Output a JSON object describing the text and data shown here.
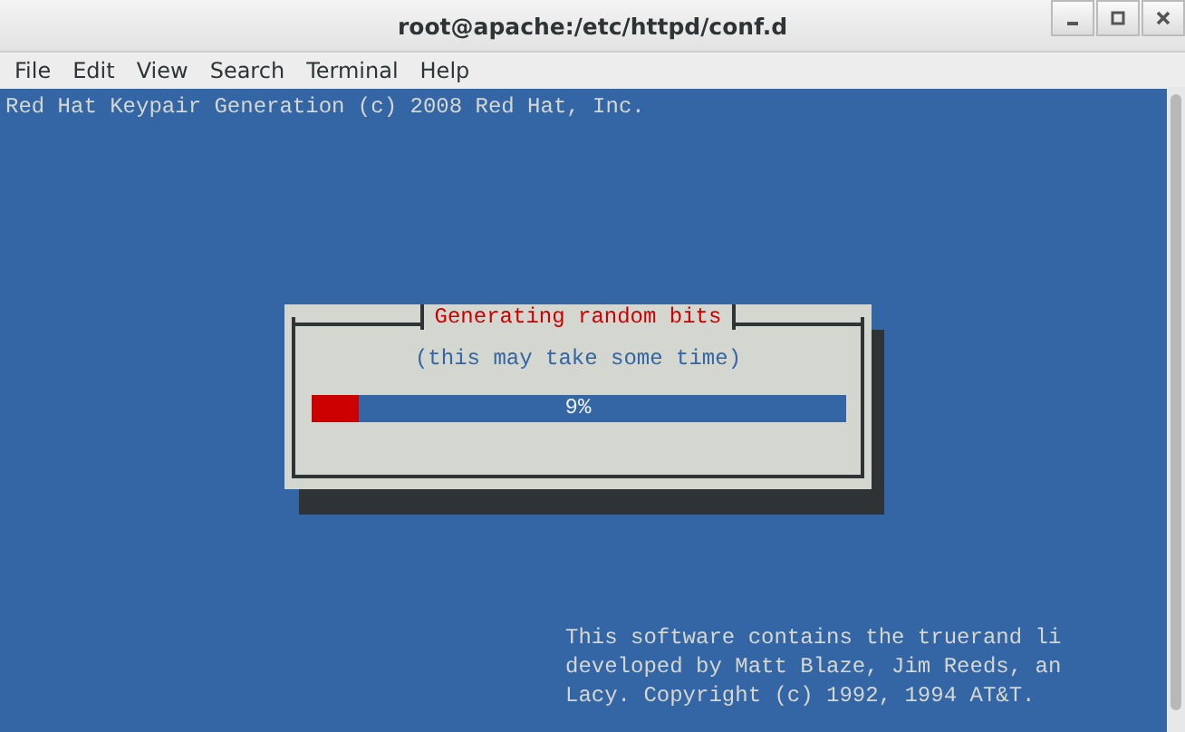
{
  "window": {
    "title": "root@apache:/etc/httpd/conf.d"
  },
  "menu": [
    "File",
    "Edit",
    "View",
    "Search",
    "Terminal",
    "Help"
  ],
  "terminal": {
    "header": "Red Hat Keypair Generation (c) 2008 Red Hat, Inc.",
    "footer": [
      "This software contains the truerand li",
      "developed by Matt Blaze, Jim Reeds, an",
      "Lacy. Copyright (c) 1992, 1994 AT&T."
    ]
  },
  "dialog": {
    "title": "Generating random bits",
    "message": "(this may take some time)",
    "progress": {
      "level": 0.09,
      "reading": "9%"
    }
  }
}
